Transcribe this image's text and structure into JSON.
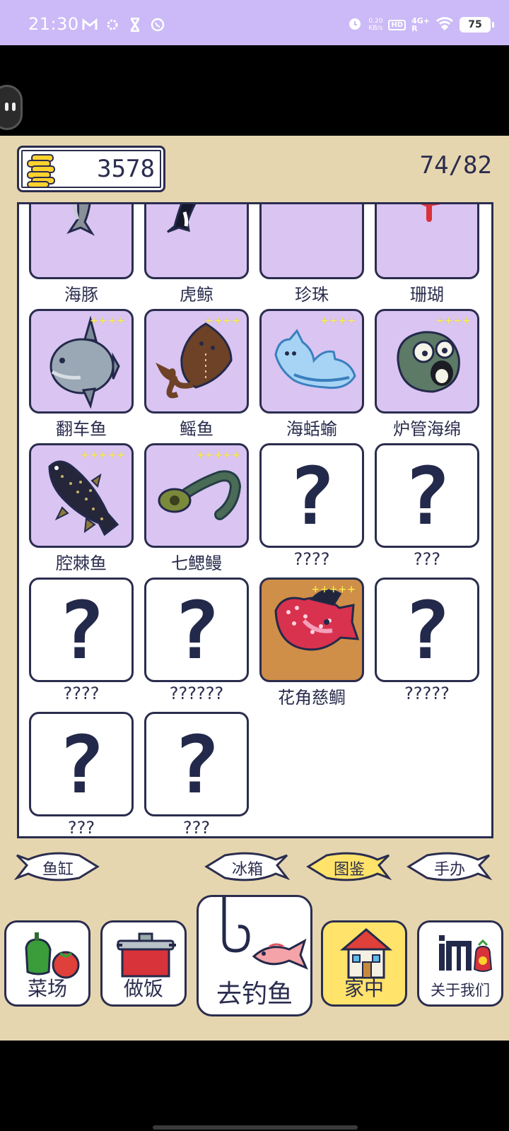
{
  "status_bar": {
    "time": "21:30",
    "icons": [
      "gmail-icon",
      "settings-cog-icon",
      "hourglass-icon",
      "whatsapp-icon"
    ],
    "alarm_icon": "alarm-icon",
    "net_speed_value": "0.20",
    "net_speed_unit": "KB/s",
    "hd": "HD",
    "network": "4G+",
    "network_sub": "R",
    "wifi_icon": "wifi-icon",
    "battery": "75"
  },
  "header": {
    "coins": "3578",
    "collection_progress": "74/82"
  },
  "collection": {
    "items": [
      {
        "name": "海豚",
        "stars": "",
        "state": "caught",
        "art": "dolphin"
      },
      {
        "name": "虎鲸",
        "stars": "",
        "state": "caught",
        "art": "orca"
      },
      {
        "name": "珍珠",
        "stars": "",
        "state": "caught",
        "art": "pearl"
      },
      {
        "name": "珊瑚",
        "stars": "",
        "state": "caught",
        "art": "coral"
      },
      {
        "name": "翻车鱼",
        "stars": "++++",
        "state": "caught",
        "art": "sunfish"
      },
      {
        "name": "鳐鱼",
        "stars": "++++",
        "state": "caught",
        "art": "ray"
      },
      {
        "name": "海蛞蝓",
        "stars": "++++",
        "state": "caught",
        "art": "seaslug"
      },
      {
        "name": "炉管海绵",
        "stars": "++++",
        "state": "caught",
        "art": "sponge"
      },
      {
        "name": "腔棘鱼",
        "stars": "+++++",
        "state": "caught",
        "art": "coelacanth"
      },
      {
        "name": "七鳃鳗",
        "stars": "+++++",
        "state": "caught",
        "art": "lamprey"
      },
      {
        "name": "????",
        "stars": "",
        "state": "unknown",
        "art": "question"
      },
      {
        "name": "???",
        "stars": "",
        "state": "unknown",
        "art": "question"
      },
      {
        "name": "????",
        "stars": "",
        "state": "unknown",
        "art": "question"
      },
      {
        "name": "??????",
        "stars": "",
        "state": "unknown",
        "art": "question"
      },
      {
        "name": "花角慈鲷",
        "stars": "+++++",
        "state": "special",
        "art": "flowerhorn"
      },
      {
        "name": "?????",
        "stars": "",
        "state": "unknown",
        "art": "question"
      },
      {
        "name": "???",
        "stars": "",
        "state": "unknown",
        "art": "question"
      },
      {
        "name": "???",
        "stars": "",
        "state": "unknown",
        "art": "question"
      }
    ],
    "unknown_mark": "?"
  },
  "tabs": [
    {
      "label": "鱼缸",
      "active": false
    },
    {
      "label": "冰箱",
      "active": false
    },
    {
      "label": "图鉴",
      "active": true
    },
    {
      "label": "手办",
      "active": false
    }
  ],
  "nav": {
    "farm": "菜场",
    "cook": "做饭",
    "fish": "去钓鱼",
    "home": "家中",
    "about": "关于我们"
  },
  "colors": {
    "status_bar": "#cbbaf7",
    "background": "#e6d6b0",
    "outline": "#2b2d4e",
    "card_purple": "#d9c4f2",
    "card_orange": "#cf8f48",
    "active_yellow": "#ffe36b",
    "star_yellow": "#fff35a"
  }
}
